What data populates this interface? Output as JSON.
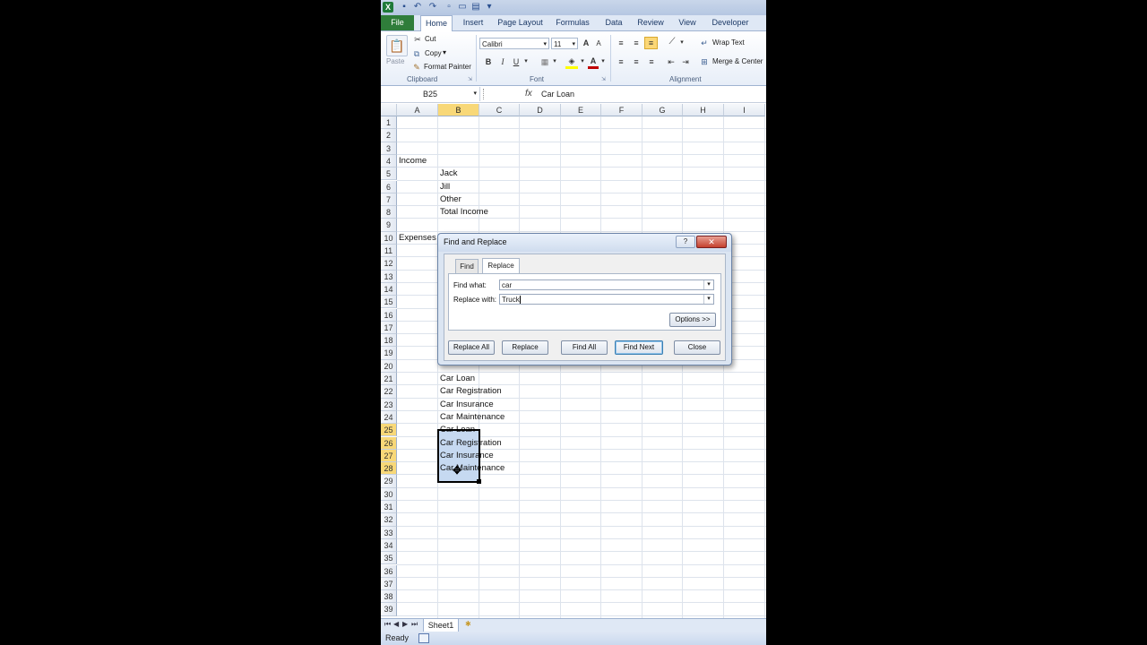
{
  "window": {
    "app_icon": "excel-icon"
  },
  "ribbon_tabs": [
    "File",
    "Home",
    "Insert",
    "Page Layout",
    "Formulas",
    "Data",
    "Review",
    "View",
    "Developer"
  ],
  "clipboard": {
    "paste": "Paste",
    "cut": "Cut",
    "copy": "Copy",
    "format_painter": "Format Painter",
    "group": "Clipboard"
  },
  "font": {
    "name": "Calibri",
    "size": "11",
    "bold": "B",
    "italic": "I",
    "underline": "U",
    "group": "Font",
    "font_color": "#c00000",
    "fill_color": "#ffff00"
  },
  "alignment": {
    "wrap_text": "Wrap Text",
    "merge_center": "Merge & Center",
    "group": "Alignment"
  },
  "formula_bar": {
    "name_box": "B25",
    "fx": "fx",
    "content": "Car Loan"
  },
  "columns": [
    "A",
    "B",
    "C",
    "D",
    "E",
    "F",
    "G",
    "H",
    "I"
  ],
  "selected_column": "B",
  "rows": [
    "1",
    "2",
    "3",
    "4",
    "5",
    "6",
    "7",
    "8",
    "9",
    "10",
    "11",
    "12",
    "13",
    "14",
    "15",
    "16",
    "17",
    "18",
    "19",
    "20",
    "21",
    "22",
    "23",
    "24",
    "25",
    "26",
    "27",
    "28",
    "29",
    "30",
    "31",
    "32",
    "33",
    "34",
    "35",
    "36",
    "37",
    "38",
    "39"
  ],
  "selected_rows": [
    "25",
    "26",
    "27",
    "28"
  ],
  "cells": {
    "A4": "Income",
    "B5": "Jack",
    "B6": "Jill",
    "B7": "Other",
    "B8": "Total Income",
    "A10": "Expenses",
    "B21": "Car Loan",
    "B22": "Car Registration",
    "B23": "Car Insurance",
    "B24": "Car Maintenance",
    "B25": "Car Loan",
    "B26": "Car Registration",
    "B27": "Car Insurance",
    "B28": "Car Maintenance"
  },
  "sheet_tabs": {
    "sheet1": "Sheet1"
  },
  "status_bar": {
    "text": "Ready"
  },
  "dialog": {
    "title": "Find and Replace",
    "help": "?",
    "close_x": "✕",
    "tabs": [
      "Find",
      "Replace"
    ],
    "active_tab": "Replace",
    "find_what_label": "Find what:",
    "find_what_value": "car",
    "replace_with_label": "Replace with:",
    "replace_with_value": "Truck",
    "options_button": "Options >>",
    "buttons": {
      "replace_all": "Replace All",
      "replace": "Replace",
      "find_all": "Find All",
      "find_next": "Find Next",
      "close": "Close"
    }
  }
}
